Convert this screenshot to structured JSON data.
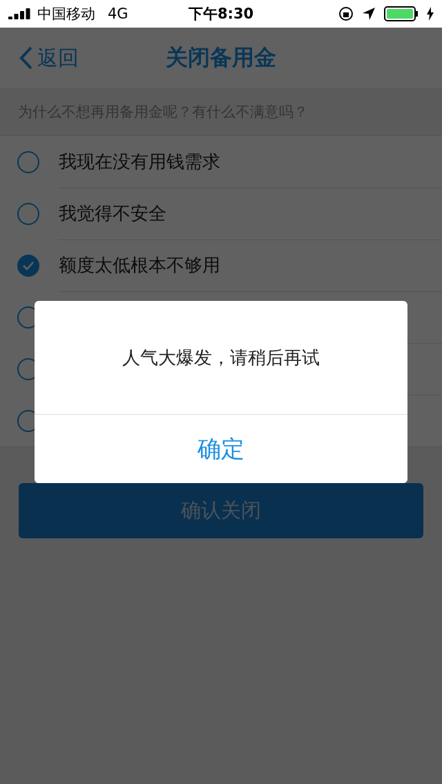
{
  "status_bar": {
    "carrier": "中国移动",
    "network": "4G",
    "time": "下午8:30"
  },
  "nav": {
    "back": "返回",
    "title": "关闭备用金"
  },
  "question": "为什么不想再用备用金呢？有什么不满意吗？",
  "options": [
    {
      "label": "我现在没有用钱需求",
      "selected": false
    },
    {
      "label": "我觉得不安全",
      "selected": false
    },
    {
      "label": "额度太低根本不够用",
      "selected": true
    },
    {
      "selected": false
    },
    {
      "selected": false
    },
    {
      "selected": false
    }
  ],
  "confirm_button": "确认关闭",
  "dialog": {
    "message": "人气大爆发，请稍后再试",
    "button": "确定"
  }
}
